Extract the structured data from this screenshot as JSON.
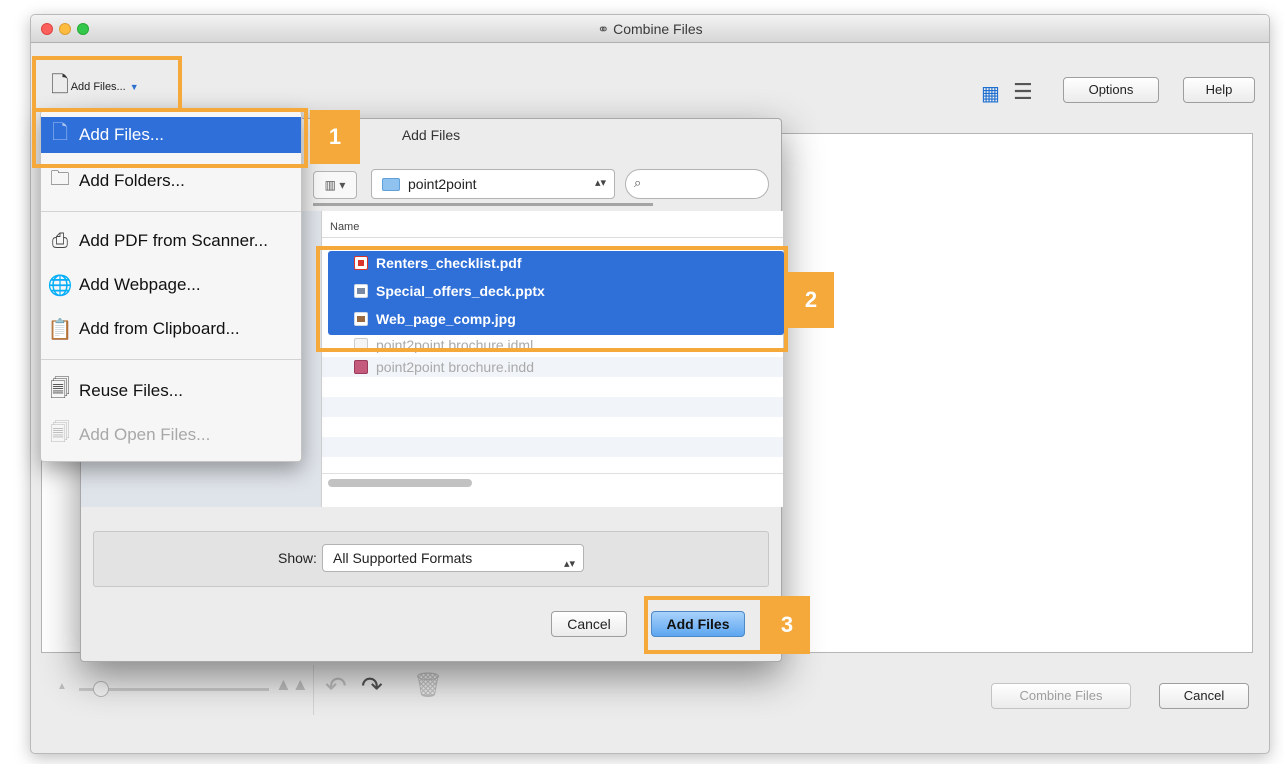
{
  "window": {
    "title": "Combine Files"
  },
  "toolbar": {
    "add_files_label": "Add Files...",
    "options_label": "Options",
    "help_label": "Help"
  },
  "footer": {
    "combine_label": "Combine Files",
    "cancel_label": "Cancel"
  },
  "menu": {
    "items": [
      {
        "label": "Add Files...",
        "icon": "add-file-icon",
        "state": "highlighted"
      },
      {
        "label": "Add Folders...",
        "icon": "add-folder-icon",
        "state": "normal"
      },
      {
        "label": "Add PDF from Scanner...",
        "icon": "scanner-icon",
        "state": "normal"
      },
      {
        "label": "Add Webpage...",
        "icon": "globe-icon",
        "state": "normal"
      },
      {
        "label": "Add from Clipboard...",
        "icon": "clipboard-icon",
        "state": "normal"
      },
      {
        "label": "Reuse Files...",
        "icon": "reuse-file-icon",
        "state": "normal"
      },
      {
        "label": "Add Open Files...",
        "icon": "open-files-icon",
        "state": "disabled"
      }
    ]
  },
  "dialog": {
    "title": "Add Files",
    "location": "point2point",
    "column_header": "Name",
    "files": [
      {
        "name": "Renters_checklist.pdf",
        "icon": "pdf-icon",
        "selected": true
      },
      {
        "name": "Special_offers_deck.pptx",
        "icon": "slides-icon",
        "selected": true
      },
      {
        "name": "Web_page_comp.jpg",
        "icon": "image-icon",
        "selected": true
      },
      {
        "name": "point2point brochure.idml",
        "icon": "idml-icon",
        "selected": false
      },
      {
        "name": "point2point brochure.indd",
        "icon": "indd-icon",
        "selected": false
      }
    ],
    "show_label": "Show:",
    "format": "All Supported Formats",
    "cancel_label": "Cancel",
    "add_label": "Add Files"
  },
  "callouts": [
    "1",
    "2",
    "3"
  ],
  "accent_color": "#f4a93a",
  "selection_color": "#2e6fd8"
}
